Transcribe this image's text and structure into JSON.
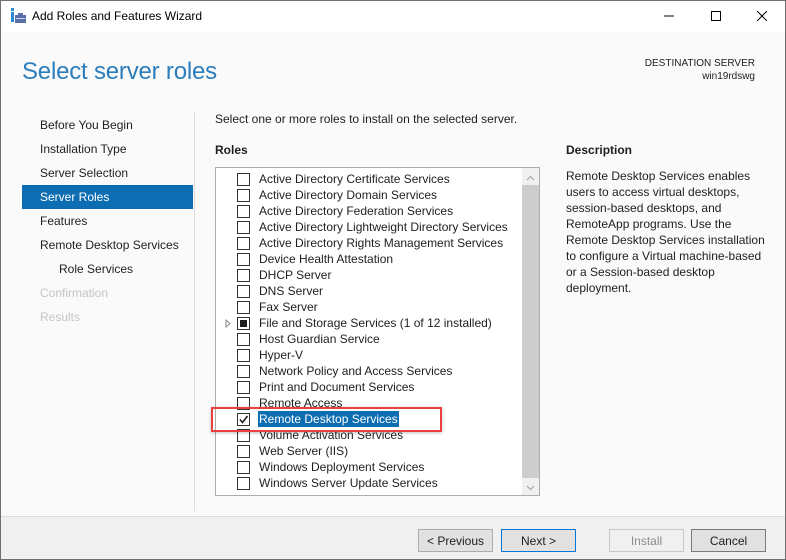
{
  "window": {
    "title": "Add Roles and Features Wizard",
    "controls": {
      "minimize": "minimize",
      "maximize": "maximize",
      "close": "close"
    }
  },
  "header": {
    "page_title": "Select server roles",
    "destination_label": "DESTINATION SERVER",
    "destination_name": "win19rdswg"
  },
  "nav": {
    "items": [
      {
        "label": "Before You Begin",
        "state": "normal"
      },
      {
        "label": "Installation Type",
        "state": "normal"
      },
      {
        "label": "Server Selection",
        "state": "normal"
      },
      {
        "label": "Server Roles",
        "state": "active"
      },
      {
        "label": "Features",
        "state": "normal"
      },
      {
        "label": "Remote Desktop Services",
        "state": "normal"
      },
      {
        "label": "Role Services",
        "state": "sub"
      },
      {
        "label": "Confirmation",
        "state": "disabled"
      },
      {
        "label": "Results",
        "state": "disabled"
      }
    ]
  },
  "main": {
    "instructions": "Select one or more roles to install on the selected server.",
    "roles_label": "Roles",
    "roles": [
      {
        "label": "Active Directory Certificate Services",
        "checked": false
      },
      {
        "label": "Active Directory Domain Services",
        "checked": false
      },
      {
        "label": "Active Directory Federation Services",
        "checked": false
      },
      {
        "label": "Active Directory Lightweight Directory Services",
        "checked": false
      },
      {
        "label": "Active Directory Rights Management Services",
        "checked": false
      },
      {
        "label": "Device Health Attestation",
        "checked": false
      },
      {
        "label": "DHCP Server",
        "checked": false
      },
      {
        "label": "DNS Server",
        "checked": false
      },
      {
        "label": "Fax Server",
        "checked": false
      },
      {
        "label": "File and Storage Services (1 of 12 installed)",
        "checked": "partial",
        "expandable": true
      },
      {
        "label": "Host Guardian Service",
        "checked": false
      },
      {
        "label": "Hyper-V",
        "checked": false
      },
      {
        "label": "Network Policy and Access Services",
        "checked": false
      },
      {
        "label": "Print and Document Services",
        "checked": false
      },
      {
        "label": "Remote Access",
        "checked": false
      },
      {
        "label": "Remote Desktop Services",
        "checked": true,
        "selected": true
      },
      {
        "label": "Volume Activation Services",
        "checked": false
      },
      {
        "label": "Web Server (IIS)",
        "checked": false
      },
      {
        "label": "Windows Deployment Services",
        "checked": false
      },
      {
        "label": "Windows Server Update Services",
        "checked": false
      }
    ]
  },
  "description": {
    "title": "Description",
    "text": "Remote Desktop Services enables users to access virtual desktops, session-based desktops, and RemoteApp programs. Use the Remote Desktop Services installation to configure a Virtual machine-based or a Session-based desktop deployment."
  },
  "footer": {
    "previous_label": "< Previous",
    "next_label": "Next >",
    "install_label": "Install",
    "cancel_label": "Cancel"
  },
  "colors": {
    "accent": "#0d6db3",
    "title_blue": "#2b7dbc",
    "highlight_red": "#e8413f"
  }
}
